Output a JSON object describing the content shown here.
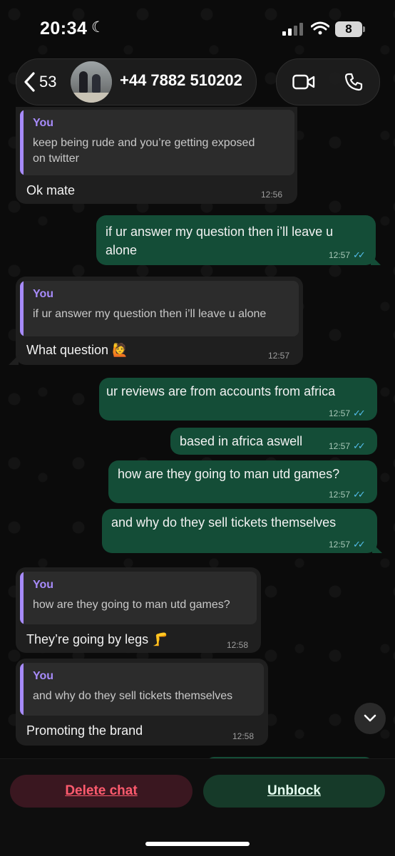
{
  "status_bar": {
    "time": "20:34",
    "battery": "8"
  },
  "header": {
    "back_count": "53",
    "contact": "+44 7882 510202"
  },
  "messages": [
    {
      "quote_name": "You",
      "quote_text": "keep being rude and you’re getting exposed\non twitter",
      "text": "Ok mate",
      "time": "12:56"
    },
    {
      "text": "if ur answer my question then i’ll leave u\nalone",
      "time": "12:57"
    },
    {
      "quote_name": "You",
      "quote_text": "if ur answer my question then i’ll leave u alone",
      "text": "What question 🙋",
      "time": "12:57"
    },
    {
      "text": "ur reviews are from accounts from africa",
      "time": "12:57"
    },
    {
      "text": "based in africa aswell",
      "time": "12:57"
    },
    {
      "text": "how are they going to man utd games?",
      "time": "12:57"
    },
    {
      "text": "and why do they sell tickets themselves",
      "time": "12:57"
    },
    {
      "quote_name": "You",
      "quote_text": "how are they going to man utd games?",
      "text": "They’re going by legs 🦵",
      "time": "12:58"
    },
    {
      "quote_name": "You",
      "quote_text": "and why do they sell tickets themselves",
      "text": "Promoting the brand",
      "time": "12:58"
    }
  ],
  "read_ticks": "✓✓",
  "actions": {
    "delete": "Delete chat",
    "unblock": "Unblock"
  },
  "icons": [
    "back-chevron-icon",
    "video-call-icon",
    "voice-call-icon",
    "scroll-down-icon",
    "moon-icon",
    "signal-icon",
    "wifi-icon"
  ],
  "colors": {
    "outgoing": "#144d37",
    "incoming": "#1f1f1f",
    "quote_accent": "#a78bfa",
    "read_tick": "#53bdeb",
    "delete": "#ff5b6e"
  }
}
